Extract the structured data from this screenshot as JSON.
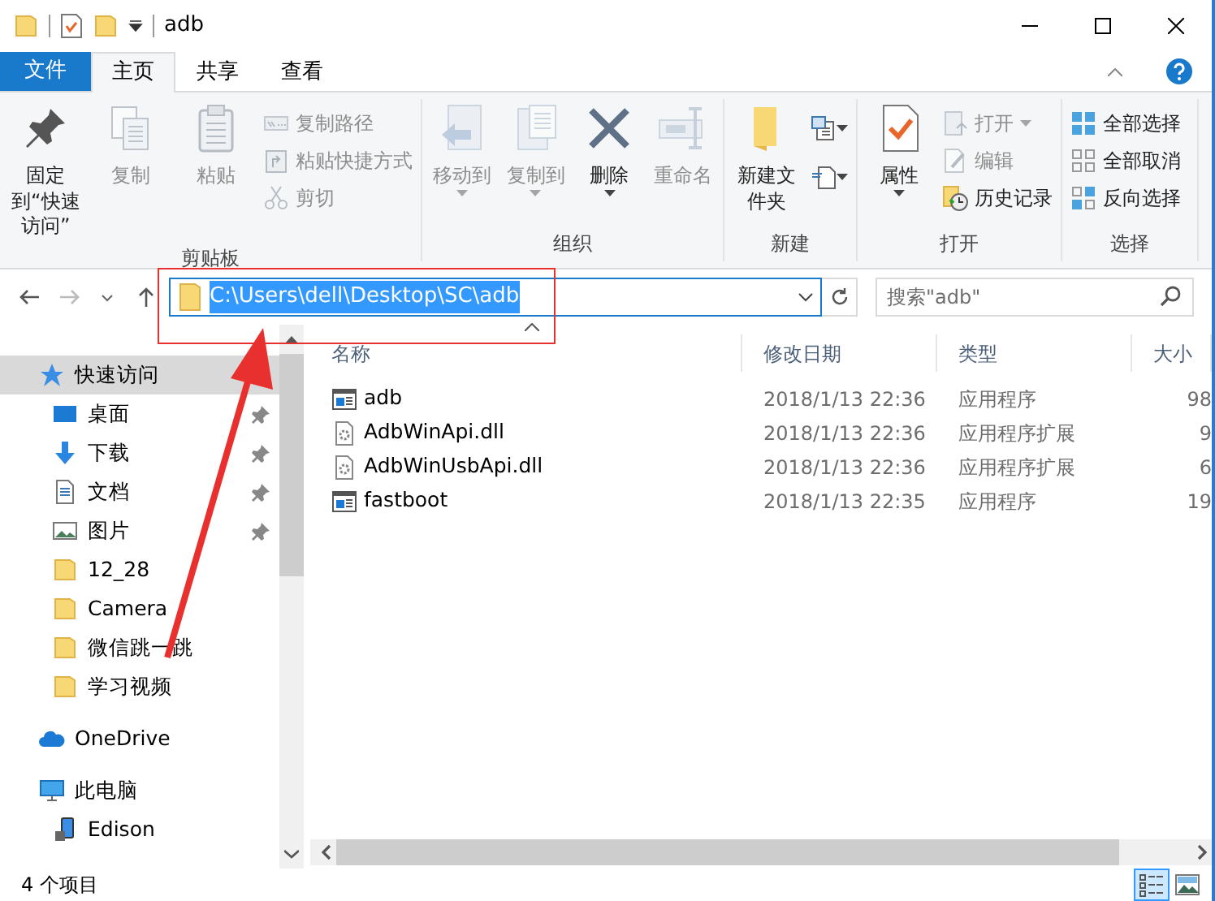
{
  "window": {
    "title": "adb"
  },
  "ribbon": {
    "file_tab": "文件",
    "tabs": [
      {
        "label": "主页",
        "selected": true
      },
      {
        "label": "共享",
        "selected": false
      },
      {
        "label": "查看",
        "selected": false
      }
    ],
    "groups": [
      {
        "name": "剪贴板",
        "buttons": [
          {
            "kind": "large",
            "label": "固定到“快速访问”",
            "disabled": false,
            "dropdown": false
          },
          {
            "kind": "large",
            "label": "复制",
            "disabled": true,
            "dropdown": false
          },
          {
            "kind": "large",
            "label": "粘贴",
            "disabled": true,
            "dropdown": false
          },
          {
            "kind": "small",
            "label": "复制路径",
            "disabled": true,
            "dropdown": false
          },
          {
            "kind": "small",
            "label": "粘贴快捷方式",
            "disabled": true,
            "dropdown": false
          },
          {
            "kind": "small",
            "label": "剪切",
            "disabled": true,
            "dropdown": false
          }
        ]
      },
      {
        "name": "组织",
        "buttons": [
          {
            "kind": "large",
            "label": "移动到",
            "disabled": true,
            "dropdown": true
          },
          {
            "kind": "large",
            "label": "复制到",
            "disabled": true,
            "dropdown": true
          },
          {
            "kind": "large",
            "label": "删除",
            "disabled": false,
            "dropdown": true
          },
          {
            "kind": "large",
            "label": "重命名",
            "disabled": true,
            "dropdown": false
          }
        ]
      },
      {
        "name": "新建",
        "buttons": [
          {
            "kind": "large",
            "label": "新建文件夹",
            "disabled": false,
            "dropdown": false
          },
          {
            "kind": "icon",
            "disabled": false,
            "dropdown": true
          },
          {
            "kind": "icon",
            "disabled": false,
            "dropdown": true
          }
        ]
      },
      {
        "name": "打开",
        "buttons": [
          {
            "kind": "large",
            "label": "属性",
            "disabled": false,
            "dropdown": true
          },
          {
            "kind": "small",
            "label": "打开",
            "disabled": true,
            "dropdown": true
          },
          {
            "kind": "small",
            "label": "编辑",
            "disabled": true,
            "dropdown": false
          },
          {
            "kind": "small",
            "label": "历史记录",
            "disabled": false,
            "dropdown": false
          }
        ]
      },
      {
        "name": "选择",
        "buttons": [
          {
            "kind": "small",
            "label": "全部选择",
            "disabled": false,
            "dropdown": false
          },
          {
            "kind": "small",
            "label": "全部取消",
            "disabled": false,
            "dropdown": false
          },
          {
            "kind": "small",
            "label": "反向选择",
            "disabled": false,
            "dropdown": false
          }
        ]
      }
    ]
  },
  "address": {
    "path": "C:\\Users\\dell\\Desktop\\SC\\adb",
    "selected": true
  },
  "search": {
    "placeholder": "搜索\"adb\""
  },
  "nav": {
    "items": [
      {
        "label": "快速访问",
        "selected": true,
        "children": [
          {
            "label": "桌面",
            "pinned": true
          },
          {
            "label": "下载",
            "pinned": true
          },
          {
            "label": "文档",
            "pinned": true
          },
          {
            "label": "图片",
            "pinned": true
          },
          {
            "label": "12_28",
            "pinned": false
          },
          {
            "label": "Camera",
            "pinned": false
          },
          {
            "label": "微信跳一跳",
            "pinned": false
          },
          {
            "label": "学习视频",
            "pinned": false
          }
        ]
      },
      {
        "label": "OneDrive",
        "selected": false
      },
      {
        "label": "此电脑",
        "selected": false,
        "children": [
          {
            "label": "Edison",
            "pinned": false
          }
        ]
      }
    ]
  },
  "table": {
    "columns": [
      "名称",
      "修改日期",
      "类型",
      "大小"
    ],
    "rows": [
      {
        "kind": "exe",
        "name": "adb",
        "modified": "2018/1/13 22:36",
        "type": "应用程序",
        "size": "98"
      },
      {
        "kind": "dll",
        "name": "AdbWinApi.dll",
        "modified": "2018/1/13 22:36",
        "type": "应用程序扩展",
        "size": "9"
      },
      {
        "kind": "dll",
        "name": "AdbWinUsbApi.dll",
        "modified": "2018/1/13 22:36",
        "type": "应用程序扩展",
        "size": "6"
      },
      {
        "kind": "exe",
        "name": "fastboot",
        "modified": "2018/1/13 22:35",
        "type": "应用程序",
        "size": "19"
      }
    ]
  },
  "status_bar": {
    "count": "4 个项目",
    "views": [
      {
        "selected": true
      },
      {
        "selected": false
      }
    ]
  }
}
